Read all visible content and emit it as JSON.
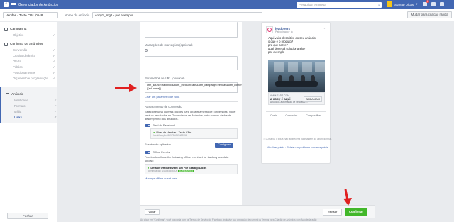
{
  "topbar": {
    "logo": "f",
    "app_title": "Gerenciador de Anúncios",
    "search_placeholder": "Pesquisar empresa",
    "profile_name": "Startup Dicas",
    "notification_count": "9"
  },
  "subbar": {
    "campaign_selector": "Vendas - Teste CPs (0548...",
    "ad_name_label": "Nome do anúncio",
    "ad_name_value": "copy1_img1 - por exemplo",
    "mode_button": "Mudar para criação rápida"
  },
  "sidebar": {
    "campaign_label": "Campanha",
    "campaign_items": [
      {
        "label": "Objetivo"
      }
    ],
    "adset_label": "Conjunto de anúncios",
    "adset_items": [
      {
        "label": "Conversão"
      },
      {
        "label": "Criativo dinâmico"
      },
      {
        "label": "Oferta"
      },
      {
        "label": "Público"
      },
      {
        "label": "Posicionamentos"
      },
      {
        "label": "Orçamento e programação"
      }
    ],
    "ad_label": "Anúncio",
    "ad_items": [
      {
        "label": "Identidade"
      },
      {
        "label": "Formato"
      },
      {
        "label": "Mídia"
      },
      {
        "label": "Links"
      }
    ],
    "close_button": "Fechar"
  },
  "editor": {
    "display_link_label": "Marcações de marcações (opcional)",
    "url_params_label": "Parâmetros de URL (opcional)",
    "url_params_value": "utm_source=facebook&utm_medium=ads&utm_campaign=vendas&utm_content={{ad.name}}",
    "build_url_link": "Criar um parâmetro de URL",
    "tracking_title": "Rastreamento de conversão",
    "tracking_desc": "Selecione uma ou mais opções para o rastreamento de conversões. Você verá os resultados no Gerenciador de Anúncios junto com os dados de desempenho dos anúncios.",
    "pixel_label": "Pixel do Facebook",
    "pixel_name": "Pixel de Vendas - Teste CPs",
    "pixel_id": "Identificação: 869750259488958",
    "app_events_label": "Eventos do aplicativo",
    "configure_button": "Configurar",
    "offline_label": "Offline Events",
    "offline_desc": "Facebook will use the following offline event set for tracking ads data upload:",
    "offline_set_name": "Default Offline Event Set For Startup Dicas",
    "offline_set_id": "Identificação: 144545356506",
    "offline_badge": "AUTOMÁTICO",
    "manage_offline_link": "Manage offline event sets"
  },
  "preview": {
    "page_name": "leadovers",
    "sponsored": "Patrocinado · ",
    "post_text": [
      "Aqui vai o descritivo do seu anúncio",
      "o que é o produto?",
      "pra que serve?",
      "qual dor está solucionando?",
      "por exemplo"
    ],
    "cta_site": "AMOLEADS.COM",
    "cta_title": "a copy é aqui",
    "cta_desc": "Anúncios automação de vendas e ...",
    "cta_button": "SAIBA MAIS",
    "action_like": "Curtir",
    "action_comment": "Comentar",
    "action_share": "Compartilhar",
    "note": "A marca d'água não aparecerá na imagem do anúncio final.",
    "link_update": "Atualizar prévia",
    "link_report": "Relatar um problema com esta prévia"
  },
  "bottombar": {
    "back_button": "Voltar",
    "review_button": "Revisar",
    "confirm_button": "Confirmar",
    "footnote": "Ao clicar em \"Confirmar\", você concorda com os Termos de Serviço do Facebook, inclusive sua obrigação de cumprir os Termos para Criação de Anúncios com Autodeclaração"
  },
  "colors": {
    "brand_blue": "#4267b2",
    "confirm_green": "#42b72a",
    "arrow_red": "#e02020"
  }
}
